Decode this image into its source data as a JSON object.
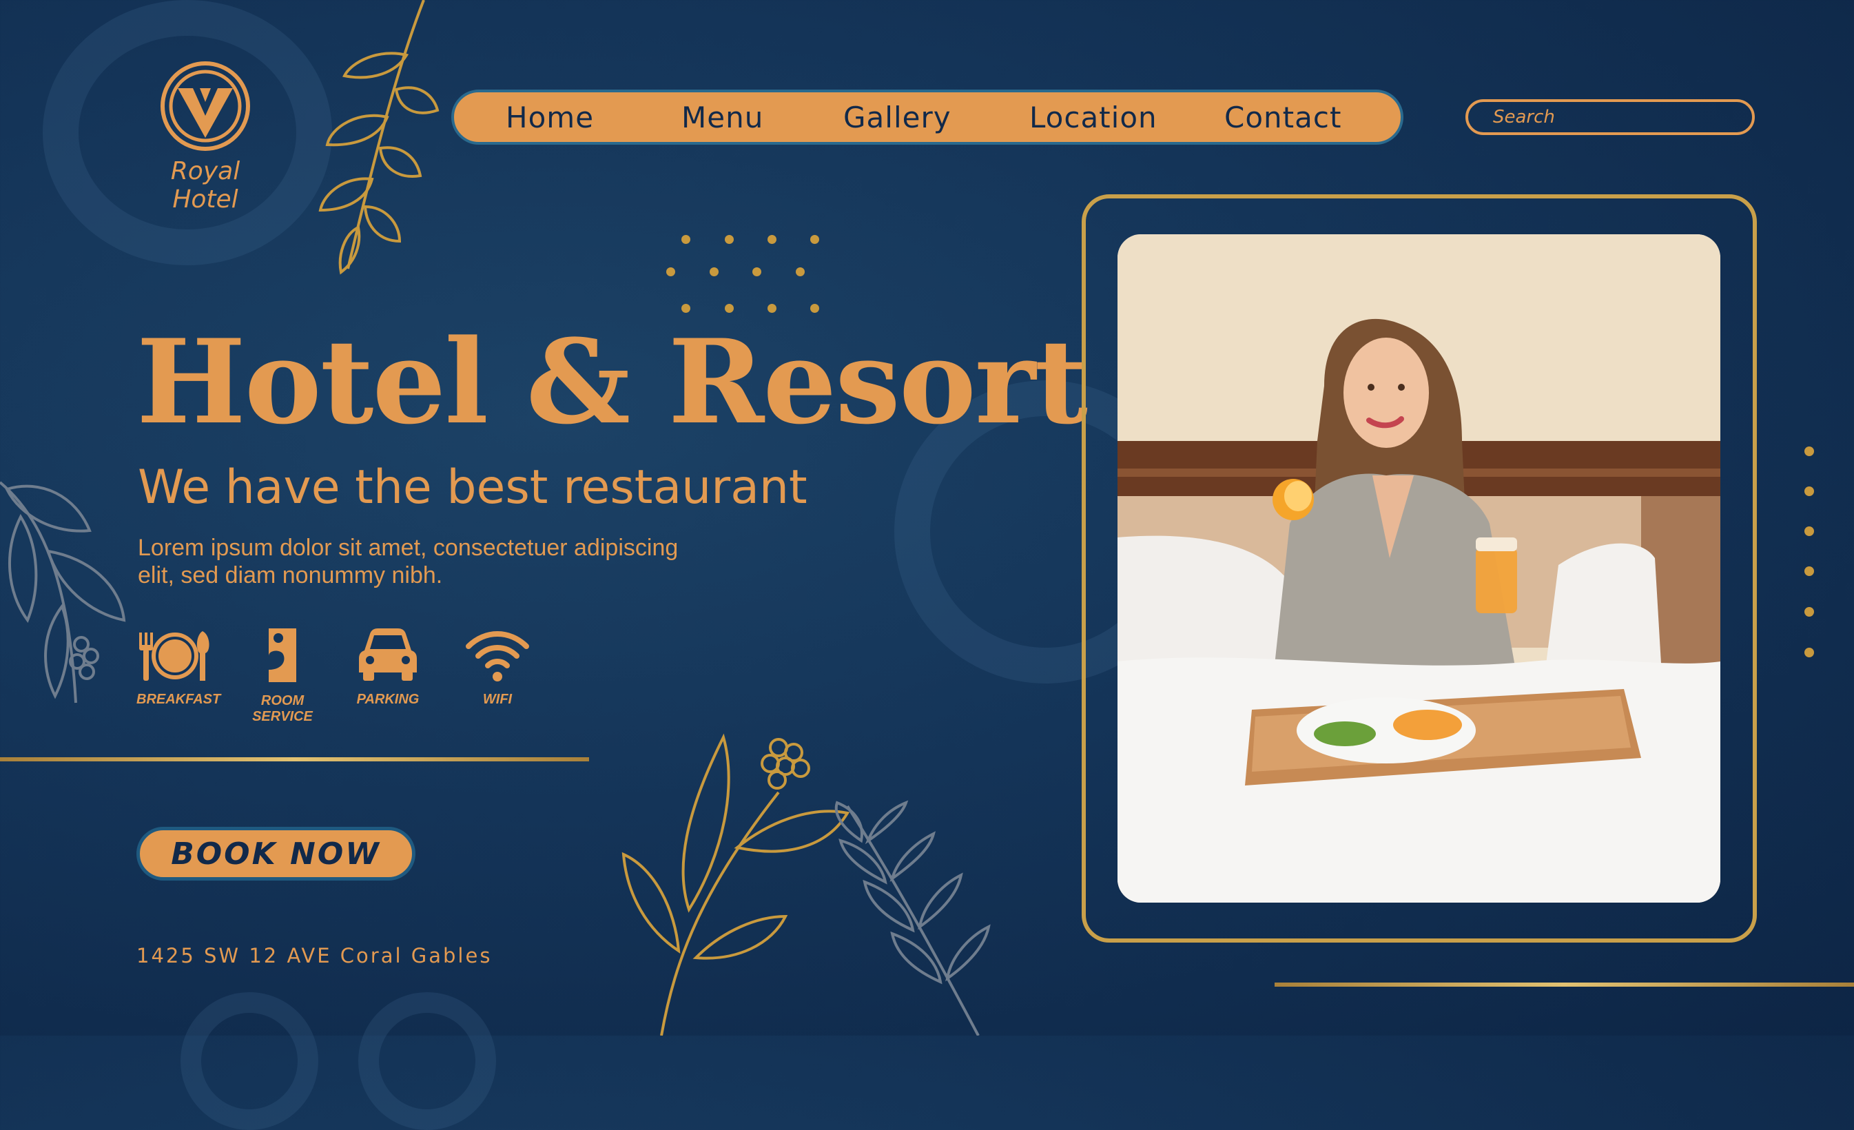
{
  "brand": {
    "name": "Royal Hotel",
    "logo_letter": "V"
  },
  "nav": {
    "items": [
      "Home",
      "Menu",
      "Gallery",
      "Location",
      "Contact"
    ]
  },
  "search": {
    "placeholder": "Search"
  },
  "hero": {
    "title": "Hotel & Resort",
    "subtitle": "We have the best restaurant",
    "body_line1": "Lorem ipsum dolor sit amet, consectetuer adipiscing",
    "body_line2": "elit, sed diam nonummy nibh."
  },
  "amenities": [
    {
      "label": "BREAKFAST",
      "icon": "plate-cutlery-icon"
    },
    {
      "label": "ROOM",
      "label2": "SERVICE",
      "icon": "door-hanger-icon"
    },
    {
      "label": "PARKING",
      "icon": "car-icon"
    },
    {
      "label": "WIFI",
      "icon": "wifi-icon"
    }
  ],
  "cta": {
    "book_label": "BOOK NOW"
  },
  "address": "1425 SW 12 AVE Coral Gables",
  "colors": {
    "accent": "#e39a51",
    "navy": "#143458",
    "gold": "#c9a04a"
  }
}
